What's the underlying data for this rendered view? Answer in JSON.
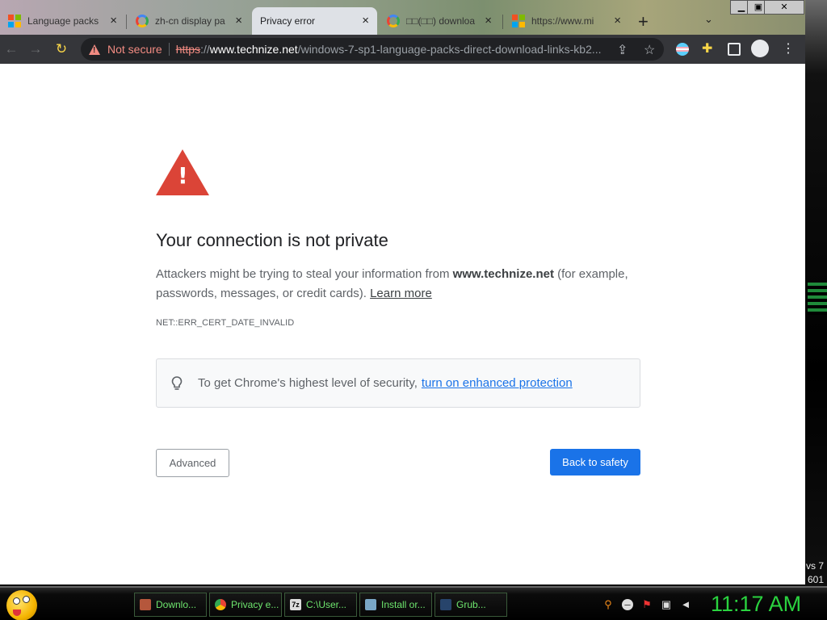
{
  "browser": {
    "tabs": [
      {
        "title": "Language packs",
        "favicon": "microsoft-logo",
        "active": false
      },
      {
        "title": "zh-cn display pa",
        "favicon": "google-logo",
        "active": false
      },
      {
        "title": "Privacy error",
        "favicon": "none",
        "active": true
      },
      {
        "title": "□□(□□) downloa",
        "favicon": "google-logo",
        "active": false
      },
      {
        "title": "https://www.mi",
        "favicon": "microsoft-logo",
        "active": false
      }
    ],
    "new_tab_symbol": "+",
    "address_bar": {
      "security_label": "Not secure",
      "scheme": "https",
      "scheme_sep": "://",
      "host": "www.technize.net",
      "path": "/windows-7-sp1-language-packs-direct-download-links-kb2..."
    }
  },
  "page": {
    "heading": "Your connection is not private",
    "para_prefix": "Attackers might be trying to steal your information from ",
    "para_host": "www.technize.net",
    "para_suffix": " (for example, passwords, messages, or credit cards). ",
    "learn_more": "Learn more",
    "error_code": "NET::ERR_CERT_DATE_INVALID",
    "security_tip": "To get Chrome's highest level of security,",
    "security_link": "turn on enhanced protection",
    "advanced_button": "Advanced",
    "back_button": "Back to safety"
  },
  "desktop": {
    "wall_text_1": "vs 7",
    "wall_text_2": "601"
  },
  "taskbar": {
    "tasks": [
      {
        "label": "Downlo...",
        "icon": "download-icon"
      },
      {
        "label": "Privacy e...",
        "icon": "chrome-icon"
      },
      {
        "label": "C:\\User...",
        "icon": "7zip-icon"
      },
      {
        "label": "Install or...",
        "icon": "installer-icon"
      },
      {
        "label": "Grub...",
        "icon": "grub-icon"
      }
    ],
    "clock": "11:17 AM"
  },
  "colors": {
    "error_red": "#db4437",
    "link_blue": "#1a73e8",
    "clock_green": "#2ad33f"
  }
}
